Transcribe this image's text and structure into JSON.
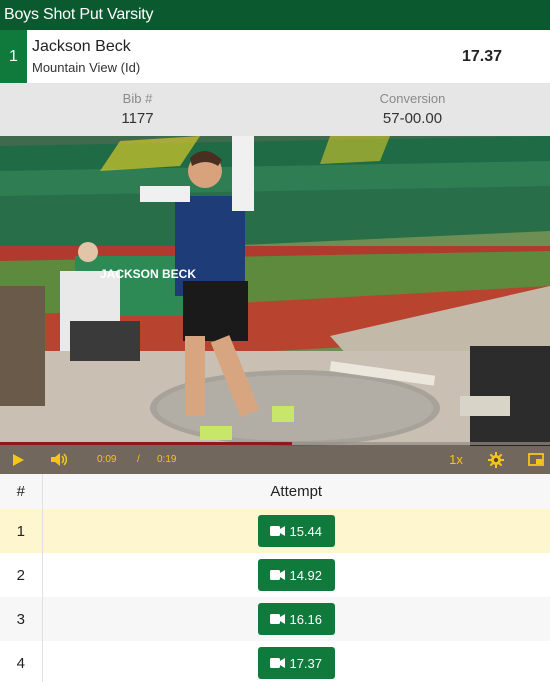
{
  "header": {
    "title": "Boys Shot Put Varsity"
  },
  "athlete": {
    "place": "1",
    "name": "Jackson Beck",
    "team": "Mountain View (Id)",
    "mark": "17.37"
  },
  "stats": {
    "bib_label": "Bib #",
    "bib_value": "1177",
    "conversion_label": "Conversion",
    "conversion_value": "57-00.00"
  },
  "video": {
    "banner_text": "JACKSON BECK",
    "current_time": "0:09",
    "separator": "/",
    "duration": "0:19",
    "progress_fraction": 0.53,
    "playback_rate": "1x",
    "controls": [
      "play-icon",
      "volume-icon",
      "gear-icon",
      "picture-in-picture-icon"
    ],
    "accent_color": "#f5c518",
    "progress_color": "#8b1a1a"
  },
  "attempts": {
    "col_number": "#",
    "col_attempt": "Attempt",
    "rows": [
      {
        "number": "1",
        "mark": "15.44"
      },
      {
        "number": "2",
        "mark": "14.92"
      },
      {
        "number": "3",
        "mark": "16.16"
      },
      {
        "number": "4",
        "mark": "17.37"
      }
    ]
  },
  "colors": {
    "header": "#0b5a2f",
    "brand_green": "#0f7a3c",
    "highlight_row": "#fdf6cf"
  }
}
